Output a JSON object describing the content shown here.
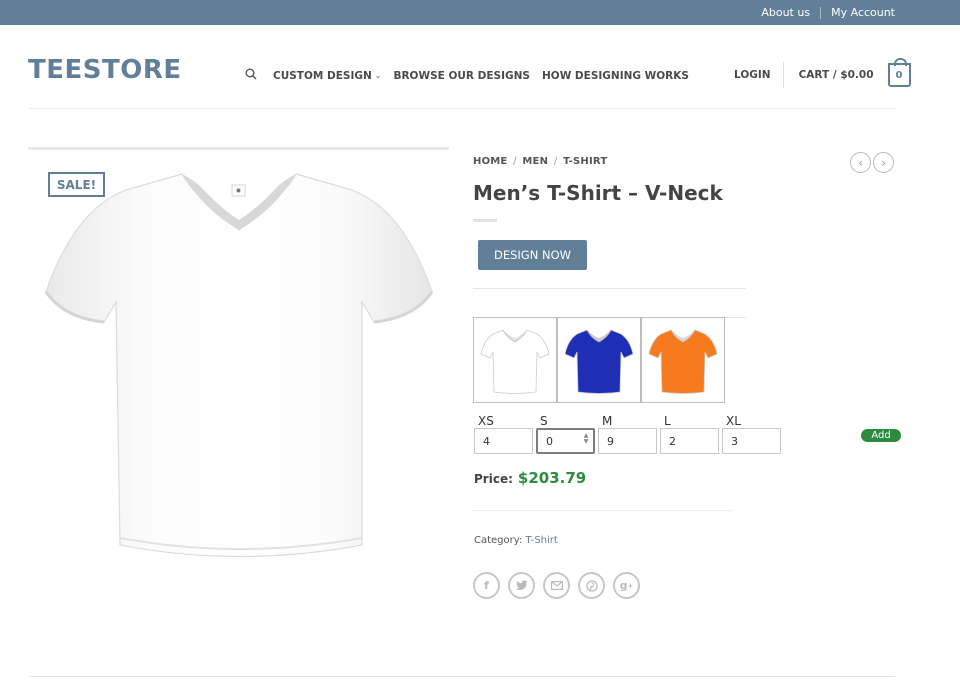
{
  "topbar": {
    "about": "About us",
    "account": "My Account"
  },
  "header": {
    "logo": "TEESTORE",
    "nav": [
      {
        "label": "CUSTOM DESIGN"
      },
      {
        "label": "BROWSE OUR DESIGNS"
      },
      {
        "label": "HOW DESIGNING WORKS"
      }
    ],
    "login": "LOGIN",
    "cart": "CART / $0.00",
    "cart_count": "0"
  },
  "product": {
    "sale_badge": "SALE!",
    "breadcrumb": [
      "HOME",
      "MEN",
      "T-SHIRT"
    ],
    "title": "Men’s T-Shirt – V-Neck",
    "design_button": "DESIGN NOW",
    "swatch_colors": [
      "#ffffff",
      "#1f2fb5",
      "#f77a1f"
    ],
    "sizes": [
      {
        "label": "XS",
        "value": "4"
      },
      {
        "label": "S",
        "value": "0"
      },
      {
        "label": "M",
        "value": "9"
      },
      {
        "label": "L",
        "value": "2"
      },
      {
        "label": "XL",
        "value": "3"
      }
    ],
    "add_button": "Add",
    "price_label": "Price:",
    "price": "$203.79",
    "category_label": "Category:",
    "category": "T-Shirt"
  },
  "colors": {
    "accent": "#627f9a",
    "price": "#2c8c3e",
    "add": "#2d8a3e"
  },
  "social_icons": [
    "facebook-icon",
    "twitter-icon",
    "email-icon",
    "pinterest-icon",
    "google-plus-icon"
  ]
}
